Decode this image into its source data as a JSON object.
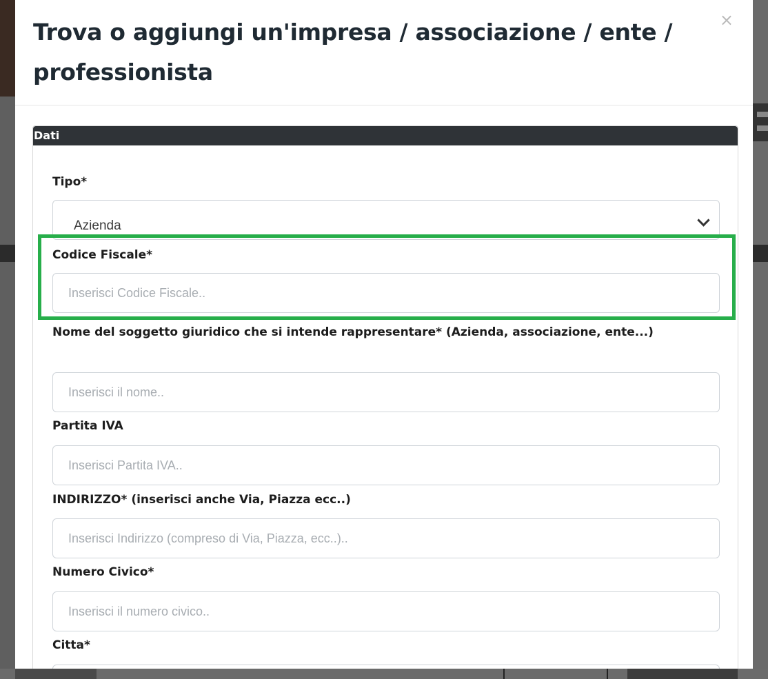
{
  "modal": {
    "title": "Trova o aggiungi un'impresa / associazione / ente / professionista",
    "close_symbol": "×"
  },
  "panel": {
    "heading": "Dati"
  },
  "form": {
    "tipo": {
      "label": "Tipo*",
      "value": "Azienda"
    },
    "codice_fiscale": {
      "label": "Codice Fiscale*",
      "placeholder": "Inserisci Codice Fiscale.."
    },
    "nome": {
      "label": "Nome del soggetto giuridico che si intende rappresentare* (Azienda, associazione, ente...)",
      "placeholder": "Inserisci il nome.."
    },
    "partita_iva": {
      "label": "Partita IVA",
      "placeholder": "Inserisci Partita IVA.."
    },
    "indirizzo": {
      "label": "INDIRIZZO* (inserisci anche Via, Piazza ecc..)",
      "placeholder": "Inserisci Indirizzo (compreso di Via, Piazza, ecc..).."
    },
    "numero_civico": {
      "label": "Numero Civico*",
      "placeholder": "Inserisci il numero civico.."
    },
    "citta": {
      "label": "Citta*"
    }
  },
  "colors": {
    "highlight": "#27ae4a",
    "panel_heading_bg": "#2f3337",
    "title_text": "#1f2a33"
  },
  "icons": {
    "close": "close-icon",
    "select_arrow": "chevron-down-icon"
  }
}
